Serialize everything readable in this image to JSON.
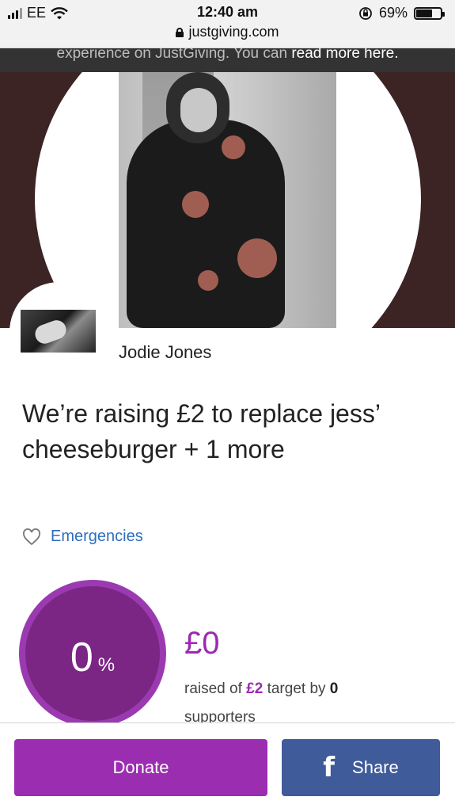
{
  "status_bar": {
    "carrier": "EE",
    "time": "12:40 am",
    "battery": "69%",
    "battery_level": 0.69,
    "url": "justgiving.com"
  },
  "banner": {
    "text": "experience on JustGiving. You can ",
    "link": "read more here."
  },
  "page": {
    "owner_name": "Jodie Jones",
    "headline": "We’re raising £2 to replace jess’ cheeseburger + 1 more",
    "category": "Emergencies"
  },
  "progress": {
    "percent": "0",
    "percent_symbol": "%",
    "raised": "£0",
    "desc_prefix": "raised of ",
    "target": "£2",
    "desc_middle": " target by ",
    "supporters_count": "0",
    "supporters_label": "supporters"
  },
  "actions": {
    "donate_label": "Donate",
    "share_label": "Share"
  },
  "colors": {
    "brand_purple": "#9b2db0",
    "facebook_blue": "#3f5b9a",
    "link_blue": "#2e6ebd"
  },
  "icons": [
    "signal-icon",
    "wifi-icon",
    "lock-icon",
    "orientation-lock-icon",
    "battery-icon",
    "heart-icon",
    "facebook-icon"
  ]
}
